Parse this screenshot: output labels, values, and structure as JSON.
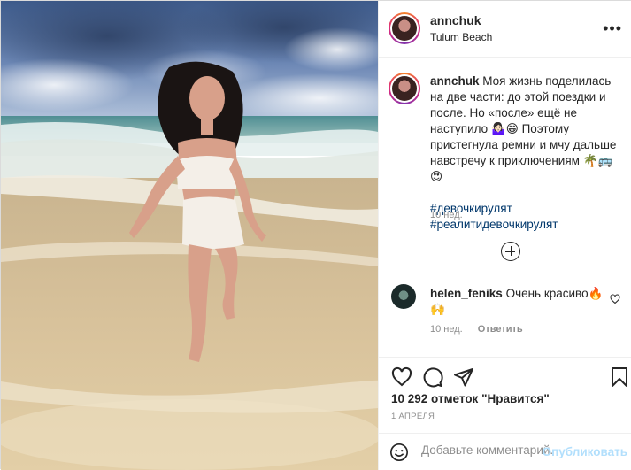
{
  "post": {
    "username": "annchuk",
    "location": "Tulum Beach",
    "more_icon": "more-icon",
    "photo_icon": "beach-photo"
  },
  "caption": {
    "username": "annchuk",
    "text": "Моя жизнь поделилась на две части: до этой поездки и после. Но «после» ещё не наступило 🤷🏻‍♀️😁 Поэтому пристегнула ремни и мчу дальше навстречу к приключениям 🌴🚌😍",
    "hashtags": [
      "#девочкирулят",
      "#реалитидевочкирулят"
    ],
    "age": "10 нед."
  },
  "comments": [
    {
      "username": "helen_feniks",
      "text": "Очень красиво🔥🙌",
      "age": "10 нед.",
      "reply_label": "Ответить"
    }
  ],
  "likes": "10 292 отметок \"Нравится\"",
  "date": "1 АПРЕЛЯ",
  "comment_input": {
    "placeholder": "Добавьте комментарий...",
    "publish_label": "Опубликовать"
  },
  "colors": {
    "link": "#00376b",
    "muted": "#8e8e8e",
    "publish_disabled": "#b2dffc"
  }
}
